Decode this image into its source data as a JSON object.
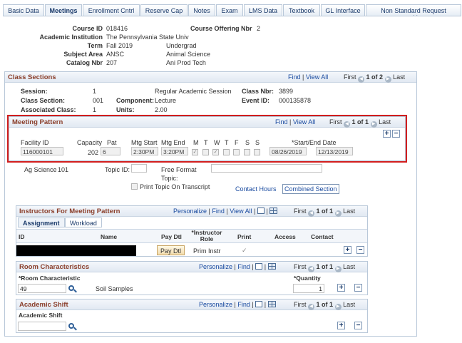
{
  "tabs": [
    {
      "label": "Basic Data",
      "active": false
    },
    {
      "label": "Meetings",
      "active": true
    },
    {
      "label": "Enrollment Cntrl",
      "active": false
    },
    {
      "label": "Reserve Cap",
      "active": false
    },
    {
      "label": "Notes",
      "active": false
    },
    {
      "label": "Exam",
      "active": false
    },
    {
      "label": "LMS Data",
      "active": false
    },
    {
      "label": "Textbook",
      "active": false
    },
    {
      "label": "GL Interface",
      "active": false
    },
    {
      "label": "Non Standard Request tracking",
      "active": false
    }
  ],
  "course": {
    "course_id_label": "Course ID",
    "course_id": "018416",
    "offering_label": "Course Offering Nbr",
    "offering": "2",
    "institution_label": "Academic Institution",
    "institution": "The Pennsylvania State Univ",
    "term_label": "Term",
    "term": "Fall 2019",
    "term_desc": "Undergrad",
    "subject_label": "Subject Area",
    "subject": "ANSC",
    "subject_desc": "Animal Science",
    "catalog_label": "Catalog Nbr",
    "catalog": "207",
    "catalog_desc": "Ani Prod Tech"
  },
  "class_sections": {
    "title": "Class Sections",
    "find": "Find",
    "view_all": "View All",
    "first": "First",
    "count": "1 of 2",
    "last": "Last",
    "session_label": "Session:",
    "session": "1",
    "session_desc": "Regular Academic Session",
    "class_nbr_label": "Class Nbr:",
    "class_nbr": "3899",
    "section_label": "Class Section:",
    "section": "001",
    "component_label": "Component:",
    "component": "Lecture",
    "event_label": "Event ID:",
    "event": "000135878",
    "assoc_label": "Associated Class:",
    "assoc": "1",
    "units_label": "Units:",
    "units": "2.00"
  },
  "meeting_pattern": {
    "title": "Meeting Pattern",
    "find": "Find",
    "view_all": "View All",
    "first": "First",
    "count": "1 of 1",
    "last": "Last",
    "facility_label": "Facility ID",
    "capacity_label": "Capacity",
    "pat_label": "Pat",
    "start_label": "Mtg Start",
    "end_label": "Mtg End",
    "days": [
      "M",
      "T",
      "W",
      "T",
      "F",
      "S",
      "S"
    ],
    "days_checked": [
      true,
      false,
      true,
      false,
      false,
      false,
      false
    ],
    "dates_label": "*Start/End Date",
    "facility": "116000101",
    "capacity": "202",
    "pat": "6",
    "mtg_start": "2:30PM",
    "mtg_end": "3:20PM",
    "start_date": "08/26/2019",
    "end_date": "12/13/2019",
    "facility_desc": "Ag Science",
    "facility_room": "101",
    "topic_label": "Topic ID:",
    "free_format_label": "Free Format",
    "topic2_label": "Topic:",
    "print_topic_label": "Print Topic On Transcript",
    "contact_hours": "Contact Hours",
    "combined_section": "Combined Section"
  },
  "instructors": {
    "title": "Instructors For Meeting Pattern",
    "personalize": "Personalize",
    "find": "Find",
    "view_all": "View All",
    "first": "First",
    "count": "1 of 1",
    "last": "Last",
    "tab_assignment": "Assignment",
    "tab_workload": "Workload",
    "col_id": "ID",
    "col_name": "Name",
    "col_paydtl": "Pay Dtl",
    "col_role": "*Instructor Role",
    "col_print": "Print",
    "col_access": "Access",
    "col_contact": "Contact",
    "pay_dtl_button": "Pay Dtl",
    "role": "Prim Instr"
  },
  "room": {
    "title": "Room Characteristics",
    "personalize": "Personalize",
    "find": "Find",
    "first": "First",
    "count": "1 of 1",
    "last": "Last",
    "col_char": "*Room Characteristic",
    "col_qty": "*Quantity",
    "char_value": "49",
    "char_desc": "Soil Samples",
    "qty_value": "1"
  },
  "shift": {
    "title": "Academic Shift",
    "personalize": "Personalize",
    "find": "Find",
    "first": "First",
    "count": "1 of 1",
    "last": "Last",
    "col_shift": "Academic Shift"
  }
}
